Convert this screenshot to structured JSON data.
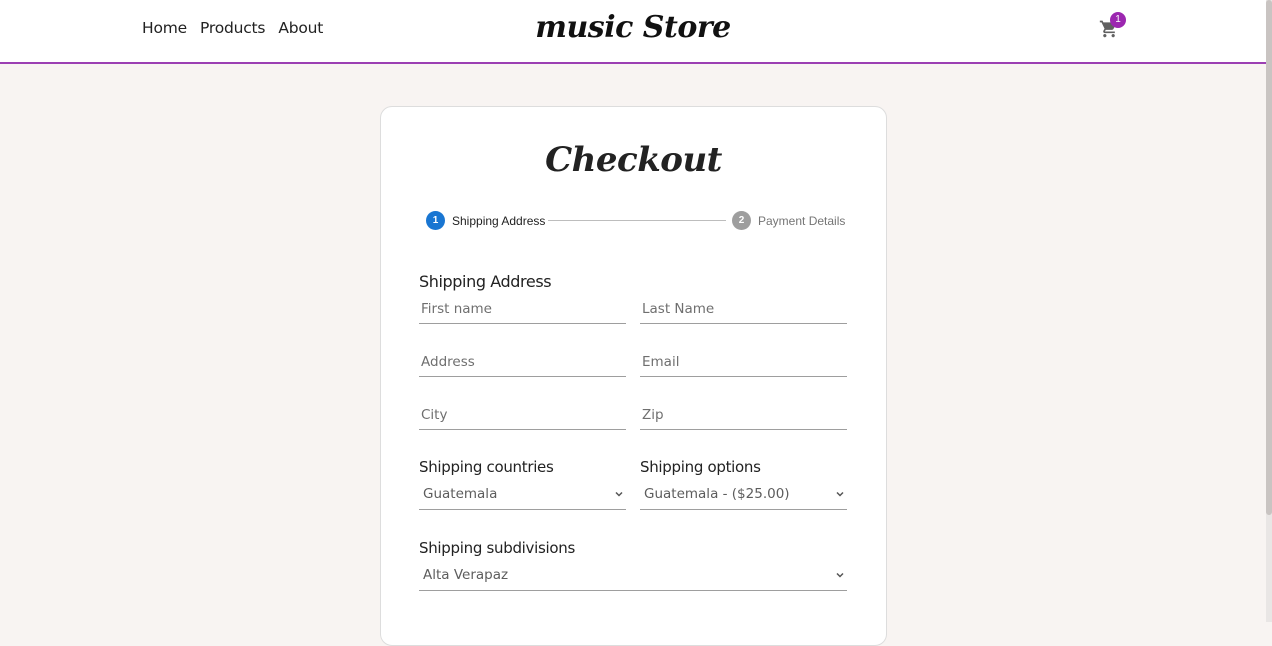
{
  "nav": {
    "home": "Home",
    "products": "Products",
    "about": "About"
  },
  "brand": {
    "logo": "music Store",
    "accent": "#9c3fb3"
  },
  "cart": {
    "count": "1",
    "icon": "cart-icon"
  },
  "checkout": {
    "title": "Checkout",
    "steps": [
      {
        "number": "1",
        "label": "Shipping Address",
        "state": "active",
        "color": "#1976d2"
      },
      {
        "number": "2",
        "label": "Payment Details",
        "state": "inactive",
        "color": "#9e9e9e"
      }
    ],
    "section_title": "Shipping Address",
    "fields": {
      "first_name": {
        "placeholder": "First name",
        "value": ""
      },
      "last_name": {
        "placeholder": "Last Name",
        "value": ""
      },
      "address": {
        "placeholder": "Address",
        "value": ""
      },
      "email": {
        "placeholder": "Email",
        "value": ""
      },
      "city": {
        "placeholder": "City",
        "value": ""
      },
      "zip": {
        "placeholder": "Zip",
        "value": ""
      }
    },
    "shipping_countries": {
      "label": "Shipping countries",
      "selected": "Guatemala"
    },
    "shipping_options": {
      "label": "Shipping options",
      "selected": "Guatemala - ($25.00)"
    },
    "shipping_subdivisions": {
      "label": "Shipping subdivisions",
      "selected": "Alta Verapaz"
    }
  }
}
